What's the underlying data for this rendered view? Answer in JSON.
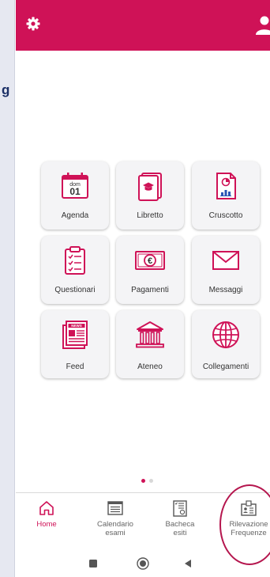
{
  "side_fragment": {
    "glyph": "g"
  },
  "colors": {
    "accent": "#cf1257",
    "tile_bg": "#f4f4f6",
    "nav_text": "#666666",
    "annotation_circle": "#b5164e"
  },
  "topbar": {
    "left_icon": "gear-icon",
    "right_icon": "user-icon"
  },
  "tiles": [
    {
      "label": "Agenda",
      "icon": "calendar-icon",
      "day": "dom",
      "date": "01"
    },
    {
      "label": "Libretto",
      "icon": "booklet-icon"
    },
    {
      "label": "Cruscotto",
      "icon": "dashboard-chart-icon"
    },
    {
      "label": "Questionari",
      "icon": "clipboard-checklist-icon"
    },
    {
      "label": "Pagamenti",
      "icon": "euro-banknote-icon"
    },
    {
      "label": "Messaggi",
      "icon": "envelope-icon"
    },
    {
      "label": "Feed",
      "icon": "newspaper-icon",
      "badge": "NEWS"
    },
    {
      "label": "Ateneo",
      "icon": "university-building-icon"
    },
    {
      "label": "Collegamenti",
      "icon": "globe-icon"
    }
  ],
  "pager": {
    "pages": 2,
    "current": 1
  },
  "bottom_nav": [
    {
      "label": "Home",
      "icon": "home-icon",
      "active": true
    },
    {
      "label": "Calendario\nesami",
      "icon": "exam-calendar-icon",
      "active": false
    },
    {
      "label": "Bacheca\nesiti",
      "icon": "results-board-icon",
      "active": false
    },
    {
      "label": "Rilevazione\nFrequenze",
      "icon": "attendance-card-icon",
      "active": false
    }
  ],
  "system_nav": [
    "recents-square-icon",
    "home-circle-icon",
    "back-triangle-icon"
  ]
}
